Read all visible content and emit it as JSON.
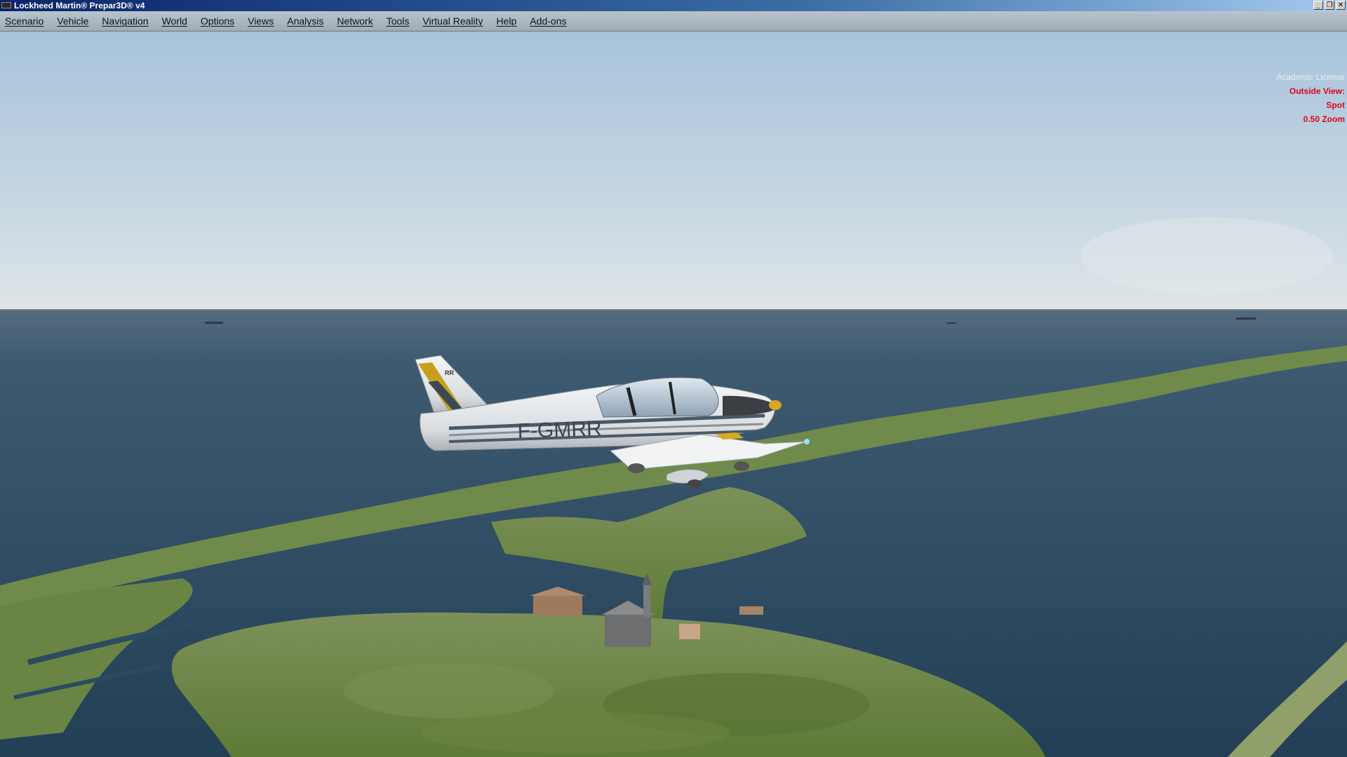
{
  "window": {
    "title": "Lockheed Martin® Prepar3D® v4",
    "buttons": {
      "minimize": "_",
      "restore": "❐",
      "close": "✕"
    }
  },
  "menu": {
    "items": [
      "Scenario",
      "Vehicle",
      "Navigation",
      "World",
      "Options",
      "Views",
      "Analysis",
      "Network",
      "Tools",
      "Virtual Reality",
      "Help",
      "Add-ons"
    ]
  },
  "hud": {
    "license": "Academic License",
    "view_label": "Outside View:",
    "view_mode": "Spot",
    "zoom": "0.50 Zoom",
    "color": "#e2001a"
  },
  "aircraft": {
    "registration": "F-GMRR",
    "tail_code": "RR"
  },
  "colors": {
    "sky_top": "#a8c4dc",
    "sky_horizon": "#dde4e7",
    "sea": "#2c4a60",
    "land": "#647f3c"
  }
}
